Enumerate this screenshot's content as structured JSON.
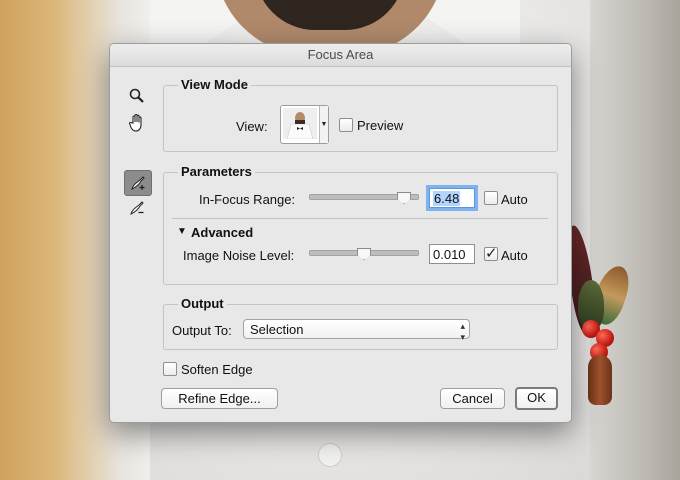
{
  "dialog": {
    "title": "Focus Area"
  },
  "tools": [
    {
      "icon": "zoom-icon"
    },
    {
      "icon": "hand-icon"
    },
    {
      "icon": "focus-area-add-brush-icon",
      "active": true
    },
    {
      "icon": "focus-area-subtract-brush-icon"
    }
  ],
  "view_mode": {
    "title": "View Mode",
    "view_label": "View:",
    "preview_label": "Preview",
    "preview_checked": false
  },
  "parameters": {
    "title": "Parameters",
    "in_focus_range_label": "In-Focus Range:",
    "in_focus_range_value": "6.48",
    "in_focus_range_slider": 0.87,
    "in_focus_auto_label": "Auto",
    "in_focus_auto_checked": false,
    "advanced_label": "Advanced",
    "noise_label": "Image Noise Level:",
    "noise_value": "0.010",
    "noise_slider": 0.5,
    "noise_auto_label": "Auto",
    "noise_auto_checked": true
  },
  "output": {
    "title": "Output",
    "output_to_label": "Output To:",
    "output_to_value": "Selection"
  },
  "soften_edge": {
    "label": "Soften Edge",
    "checked": false
  },
  "buttons": {
    "refine_edge": "Refine Edge...",
    "cancel": "Cancel",
    "ok": "OK"
  }
}
